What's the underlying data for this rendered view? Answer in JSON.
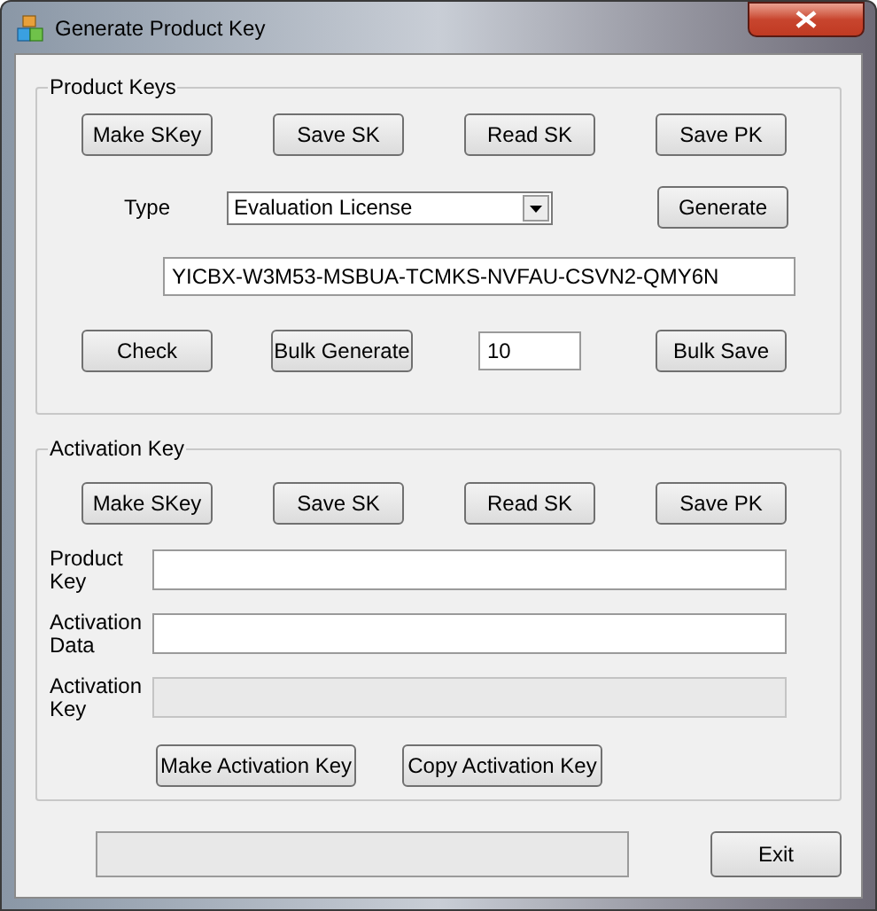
{
  "window": {
    "title": "Generate Product Key"
  },
  "product_keys": {
    "title": "Product Keys",
    "buttons": [
      "Make SKey",
      "Save SK",
      "Read SK",
      "Save PK"
    ],
    "type_label": "Type",
    "type_select": {
      "value": "Evaluation License"
    },
    "generate_button": "Generate",
    "key_field": {
      "value": "YICBX-W3M53-MSBUA-TCMKS-NVFAU-CSVN2-QMY6N"
    },
    "check_button": "Check",
    "bulk_generate_button": "Bulk Generate",
    "bulk_count": {
      "value": "10"
    },
    "bulk_save_button": "Bulk Save"
  },
  "activation_key": {
    "title": "Activation Key",
    "buttons": [
      "Make SKey",
      "Save SK",
      "Read SK",
      "Save PK"
    ],
    "fields": [
      {
        "label": "Product Key",
        "disabled": false
      },
      {
        "label": "Activation Data",
        "disabled": false
      },
      {
        "label": "Activation Key",
        "disabled": true
      }
    ],
    "actions": [
      "Make Activation Key",
      "Copy Activation Key"
    ]
  },
  "status_bar": {
    "level": 0
  },
  "exit_button": "Exit"
}
